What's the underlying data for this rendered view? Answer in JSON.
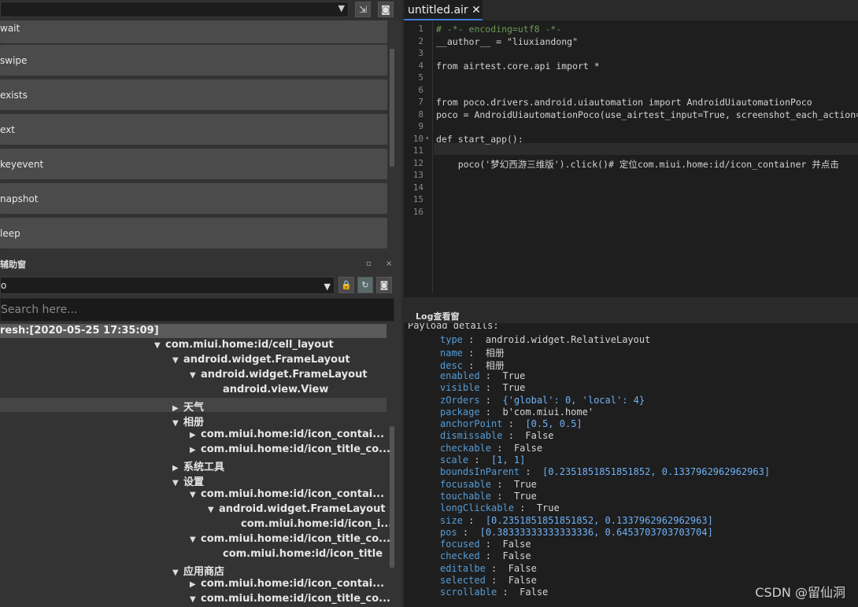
{
  "api_list": [
    "wait",
    "swipe",
    "exists",
    "ext",
    "keyevent",
    "napshot",
    "leep"
  ],
  "helper_window": {
    "title": "辅助窗",
    "restore": "▫",
    "close": "×",
    "mode_value": "o",
    "search_placeholder": "Search here...",
    "refresh_label": "resh:[2020-05-25 17:35:09]"
  },
  "tree": [
    {
      "label": "com.miui.home:id/cell_layout",
      "toggle": "▼"
    },
    {
      "label": "android.widget.FrameLayout",
      "toggle": "▼"
    },
    {
      "label": "android.widget.FrameLayout",
      "toggle": "▼"
    },
    {
      "label": "android.view.View",
      "toggle": ""
    },
    {
      "label": "天气",
      "toggle": "▶"
    },
    {
      "label": "相册",
      "toggle": "▼"
    },
    {
      "label": "com.miui.home:id/icon_contai...",
      "toggle": "▶"
    },
    {
      "label": "com.miui.home:id/icon_title_co...",
      "toggle": "▶"
    },
    {
      "label": "系统工具",
      "toggle": "▶"
    },
    {
      "label": "设置",
      "toggle": "▼"
    },
    {
      "label": "com.miui.home:id/icon_contai...",
      "toggle": "▼"
    },
    {
      "label": "android.widget.FrameLayout",
      "toggle": "▼"
    },
    {
      "label": "com.miui.home:id/icon_i...",
      "toggle": ""
    },
    {
      "label": "com.miui.home:id/icon_title_co...",
      "toggle": "▼"
    },
    {
      "label": "com.miui.home:id/icon_title",
      "toggle": ""
    },
    {
      "label": "应用商店",
      "toggle": "▼"
    },
    {
      "label": "com.miui.home:id/icon_contai...",
      "toggle": "▶"
    },
    {
      "label": "com.miui.home:id/icon_title_co...",
      "toggle": "▼"
    }
  ],
  "editor": {
    "tab_title": "untitled.air",
    "tab_close": "✕",
    "line_numbers": [
      "1",
      "2",
      "3",
      "4",
      "5",
      "6",
      "7",
      "8",
      "9",
      "10",
      "11",
      "12",
      "13",
      "14",
      "15",
      "16"
    ],
    "fold_marker": "▾",
    "lines": [
      "# -*- encoding=utf8 -*-",
      "__author__ = \"liuxiandong\"",
      "",
      "from airtest.core.api import *",
      "",
      "",
      "from poco.drivers.android.uiautomation import AndroidUiautomationPoco",
      "poco = AndroidUiautomationPoco(use_airtest_input=True, screenshot_each_action=",
      "",
      "def start_app():",
      "",
      "    poco('梦幻西游三维版').click()# 定位com.miui.home:id/icon_container 并点击",
      "",
      "",
      "",
      ""
    ]
  },
  "log": {
    "title": "Log查看窗",
    "header": "Payload details:",
    "props": [
      {
        "key": "type",
        "value": "android.widget.RelativeLayout"
      },
      {
        "key": "name",
        "value": "相册"
      },
      {
        "key": "desc",
        "value": "相册"
      },
      {
        "key": "enabled",
        "value": "True"
      },
      {
        "key": "visible",
        "value": "True"
      },
      {
        "key": "zOrders",
        "value": "{'global': 0, 'local': 4}"
      },
      {
        "key": "package",
        "value": "b'com.miui.home'"
      },
      {
        "key": "anchorPoint",
        "value": "[0.5, 0.5]"
      },
      {
        "key": "dismissable",
        "value": "False"
      },
      {
        "key": "checkable",
        "value": "False"
      },
      {
        "key": "scale",
        "value": "[1, 1]"
      },
      {
        "key": "boundsInParent",
        "value": "[0.2351851851851852, 0.1337962962962963]"
      },
      {
        "key": "focusable",
        "value": "True"
      },
      {
        "key": "touchable",
        "value": "True"
      },
      {
        "key": "longClickable",
        "value": "True"
      },
      {
        "key": "size",
        "value": "[0.2351851851851852, 0.1337962962962963]"
      },
      {
        "key": "pos",
        "value": "[0.38333333333333336, 0.6453703703703704]"
      },
      {
        "key": "focused",
        "value": "False"
      },
      {
        "key": "checked",
        "value": "False"
      },
      {
        "key": "editalbe",
        "value": "False"
      },
      {
        "key": "selected",
        "value": "False"
      },
      {
        "key": "scrollable",
        "value": "False"
      }
    ]
  },
  "watermark": "CSDN @留仙洞"
}
